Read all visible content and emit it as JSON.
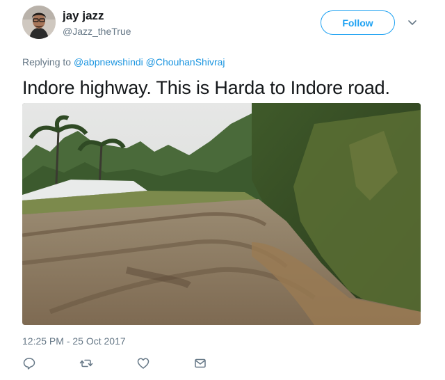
{
  "user": {
    "display_name": "jay jazz",
    "handle": "@Jazz_theTrue"
  },
  "follow_button": {
    "label": "Follow"
  },
  "reply": {
    "prefix": "Replying to",
    "mentions": [
      "@abpnewshindi",
      "@ChouhanShivraj"
    ]
  },
  "tweet": {
    "text": "Indore highway. This is Harda to Indore road.",
    "timestamp": "12:25 PM - 25 Oct 2017"
  },
  "icons": {
    "reply": "reply-icon",
    "retweet": "retweet-icon",
    "like": "heart-icon",
    "message": "envelope-icon",
    "more": "chevron-down-icon"
  },
  "colors": {
    "accent": "#1da1f2",
    "mention": "#1b95e0",
    "secondary_text": "#657786",
    "primary_text": "#14171a"
  }
}
